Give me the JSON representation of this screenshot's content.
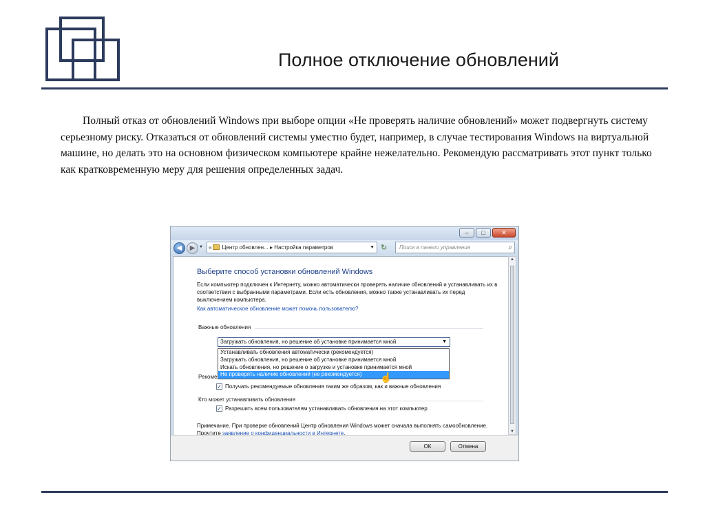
{
  "slide": {
    "title": "Полное отключение обновлений",
    "body": "Полный отказ от обновлений Windows при выборе опции «Не проверять наличие обновлений» может подвергнуть систему серьезному риску. Отказаться от обновлений системы уместно будет, например, в случае тестирования Windows на виртуальной машине, но делать это на основном физическом компьютере крайне нежелательно. Рекомендую рассматривать этот пункт только как кратковременную меру для решения определенных задач."
  },
  "window": {
    "controls": {
      "minimize": "–",
      "maximize": "□",
      "close": "✕"
    },
    "nav": {
      "back_icon": "back-arrow-icon",
      "forward_icon": "forward-arrow-icon",
      "address": {
        "prefix": "«",
        "crumb1": "Центр обновлен...",
        "sep": "▸",
        "crumb2": "Настройка параметров"
      },
      "search_placeholder": "Поиск в панели управления"
    },
    "content": {
      "heading": "Выберите способ установки обновлений Windows",
      "intro": "Если компьютер подключен к Интернету, можно автоматически проверять наличие обновлений и устанавливать их в соответствии с выбранными параметрами. Если есть обновления, можно также устанавливать их перед выключением компьютера.",
      "help_link": "Как автоматическое обновление может помочь пользователю?",
      "important_group": "Важные обновления",
      "combo_value": "Загружать обновления, но решение об установке принимается мной",
      "options": [
        "Устанавливать обновления автоматически (рекомендуется)",
        "Загружать обновления, но решение об установке принимается мной",
        "Искать обновления, но решение о загрузке и установке принимается мной",
        "Не проверять наличие обновлений (не рекомендуется)"
      ],
      "recommended_group_partial": "Рекоме",
      "recommended_checkbox": "Получать рекомендуемые обновления таким же образом, как и важные обновления",
      "who_group": "Кто может устанавливать обновления",
      "who_checkbox": "Разрешить всем пользователям устанавливать обновления на этот компьютер",
      "note_prefix": "Примечание. При проверке обновлений Центр обновления Windows может сначала выполнять самообновление. Прочтите ",
      "note_link": "заявление о конфиденциальности в Интернете",
      "note_suffix": "."
    },
    "footer": {
      "ok": "ОК",
      "cancel": "Отмена"
    }
  }
}
